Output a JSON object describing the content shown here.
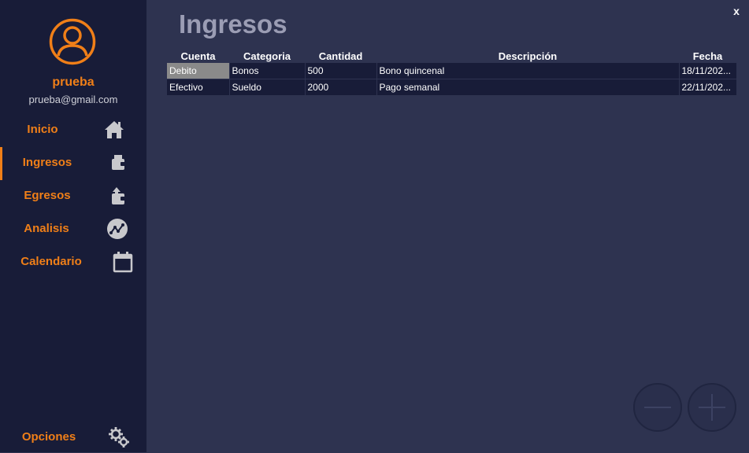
{
  "sidebar": {
    "user": {
      "name": "prueba",
      "email": "prueba@gmail.com"
    },
    "items": [
      {
        "label": "Inicio",
        "icon": "home-icon"
      },
      {
        "label": "Ingresos",
        "icon": "wallet-in-icon"
      },
      {
        "label": "Egresos",
        "icon": "wallet-out-icon"
      },
      {
        "label": "Analisis",
        "icon": "analytics-icon"
      },
      {
        "label": "Calendario",
        "icon": "calendar-icon"
      }
    ],
    "options": {
      "label": "Opciones",
      "icon": "gear-icon"
    }
  },
  "main": {
    "title": "Ingresos"
  },
  "window": {
    "close_label": "x"
  },
  "table": {
    "columns": [
      "Cuenta",
      "Categoria",
      "Cantidad",
      "Descripción",
      "Fecha"
    ],
    "rows": [
      [
        "Debito",
        "Bonos",
        "500",
        "Bono quincenal",
        "18/11/202..."
      ],
      [
        "Efectivo",
        "Sueldo",
        "2000",
        "Pago semanal",
        "22/11/202..."
      ]
    ]
  },
  "actions": {
    "remove": {
      "icon": "minus-icon"
    },
    "add": {
      "icon": "plus-icon"
    }
  },
  "colors": {
    "accent": "#f07f18",
    "sidebar_bg": "#181c38",
    "main_bg": "#2e3350",
    "title": "#9b9db4"
  }
}
